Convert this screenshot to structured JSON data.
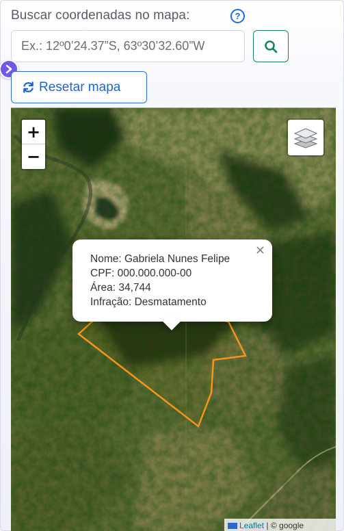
{
  "search": {
    "label": "Buscar coordenadas no mapa:",
    "help_icon": "question-circle-icon",
    "placeholder": "Ex.: 12º0’24.37”S, 63º30’32.60”W",
    "button_icon": "search-icon"
  },
  "reset": {
    "label": "Resetar mapa",
    "icon": "refresh-icon"
  },
  "sidebar_toggle_icon": "chevron-right-icon",
  "map": {
    "zoom_in": "+",
    "zoom_out": "−",
    "layers_icon": "layers-icon",
    "polygon_color": "#f7941d",
    "popup": {
      "close": "×",
      "lines": [
        "Nome: Gabriela Nunes Felipe",
        "CPF: 000.000.000-00",
        "Área: 34,744",
        "Infração: Desmatamento"
      ]
    },
    "attribution": {
      "leaflet": "Leaflet",
      "separator": "|",
      "source": "© google"
    }
  },
  "colors": {
    "accent_blue": "#1f64cf",
    "search_green": "#198754",
    "toggle_purple": "#6f5ae8"
  }
}
